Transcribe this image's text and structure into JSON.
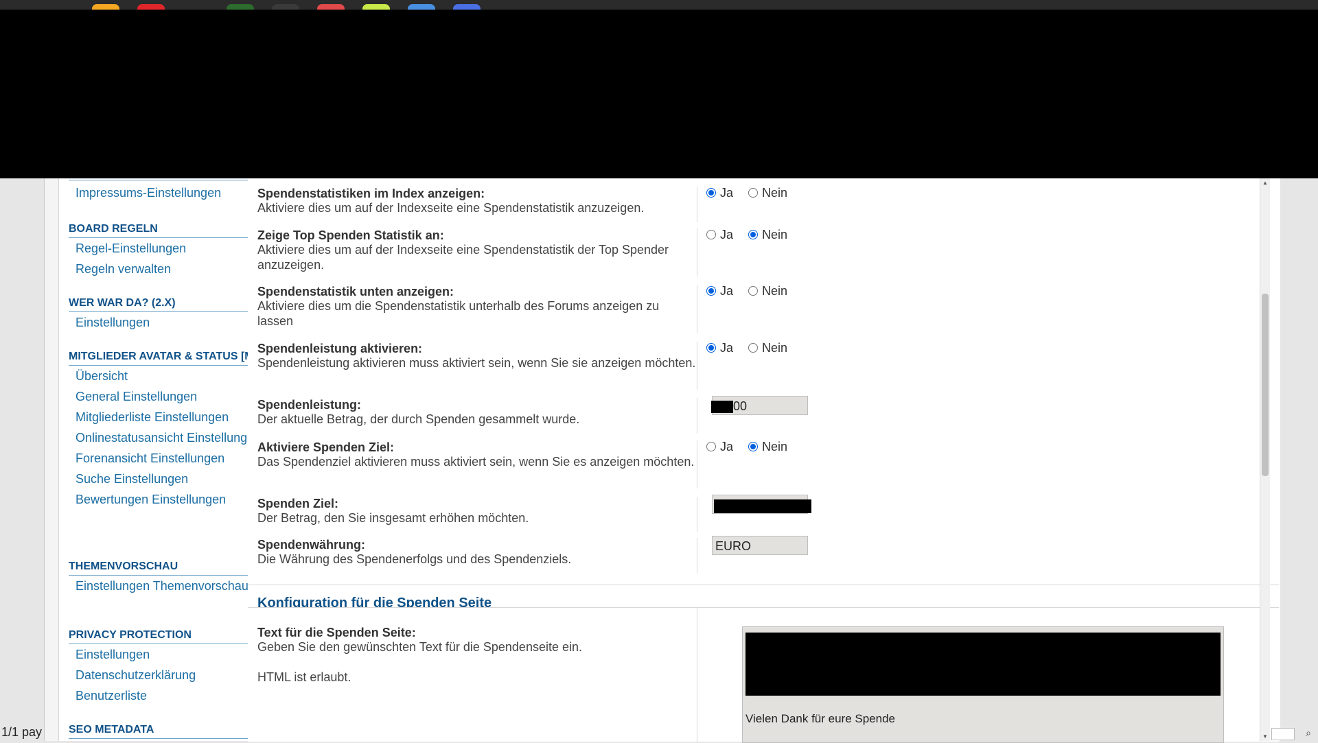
{
  "sidebar": {
    "sections": [
      {
        "title": "BOARD REGELN",
        "items": [
          "Regel-Einstellungen",
          "Regeln verwalten"
        ]
      },
      {
        "title": "WER WAR DA? (2.X)",
        "items": [
          "Einstellungen"
        ]
      },
      {
        "title": "MITGLIEDER AVATAR & STATUS [MAS]",
        "items": [
          "Übersicht",
          "General Einstellungen",
          "Mitgliederliste Einstellungen",
          "Onlinestatusansicht Einstellungen",
          "Forenansicht Einstellungen",
          "Suche Einstellungen",
          "Bewertungen Einstellungen"
        ]
      },
      {
        "title": "THEMENVORSCHAU",
        "items": [
          "Einstellungen Themenvorschau"
        ]
      },
      {
        "title": "PRIVACY PROTECTION",
        "items": [
          "Einstellungen",
          "Datenschutzerklärung",
          "Benutzerliste"
        ]
      },
      {
        "title": "SEO METADATA",
        "items": []
      }
    ],
    "top_item": "Impressums-Einstellungen"
  },
  "radio": {
    "yes": "Ja",
    "no": "Nein"
  },
  "settings": [
    {
      "title": "Spendenstatistiken im Index anzeigen:",
      "desc": "Aktiviere dies um auf der Indexseite eine Spendenstatistik anzuzeigen.",
      "type": "radio",
      "value": "yes"
    },
    {
      "title": "Zeige Top Spenden Statistik an:",
      "desc": "Aktiviere dies um auf der Indexseite eine Spendenstatistik der Top Spender anzuzeigen.",
      "type": "radio",
      "value": "no"
    },
    {
      "title": "Spendenstatistik unten anzeigen:",
      "desc": "Aktiviere dies um die Spendenstatistik unterhalb des Forums anzeigen zu lassen",
      "type": "radio",
      "value": "yes"
    },
    {
      "title": "Spendenleistung aktivieren:",
      "desc": "Spendenleistung aktivieren muss aktiviert sein, wenn Sie sie anzeigen möchten.",
      "type": "radio",
      "value": "yes"
    },
    {
      "title": "Spendenleistung:",
      "desc": "Der aktuelle Betrag, der durch Spenden gesammelt wurde.",
      "type": "text",
      "value": "00"
    },
    {
      "title": "Aktiviere Spenden Ziel:",
      "desc": "Das Spendenziel aktivieren muss aktiviert sein, wenn Sie es anzeigen möchten.",
      "type": "radio",
      "value": "no"
    },
    {
      "title": "Spenden Ziel:",
      "desc": "Der Betrag, den Sie insgesamt erhöhen möchten.",
      "type": "text",
      "value": ""
    },
    {
      "title": "Spendenwährung:",
      "desc": "Die Währung des Spendenerfolgs und des Spendenziels.",
      "type": "text",
      "value": "EURO"
    }
  ],
  "spenden_seite": {
    "section_title": "Konfiguration für die Spenden Seite",
    "field_title": "Text für die Spenden Seite:",
    "field_desc": "Geben Sie den gewünschten Text für die Spendenseite ein.",
    "field_note": "HTML ist erlaubt.",
    "textarea_visible_line": "Vielen Dank für eure Spende"
  },
  "status": {
    "page_indicator": "1/1 pay"
  },
  "colors": {
    "link": "#1c6ea4",
    "section": "#105289",
    "radio_on": "#0060df"
  }
}
